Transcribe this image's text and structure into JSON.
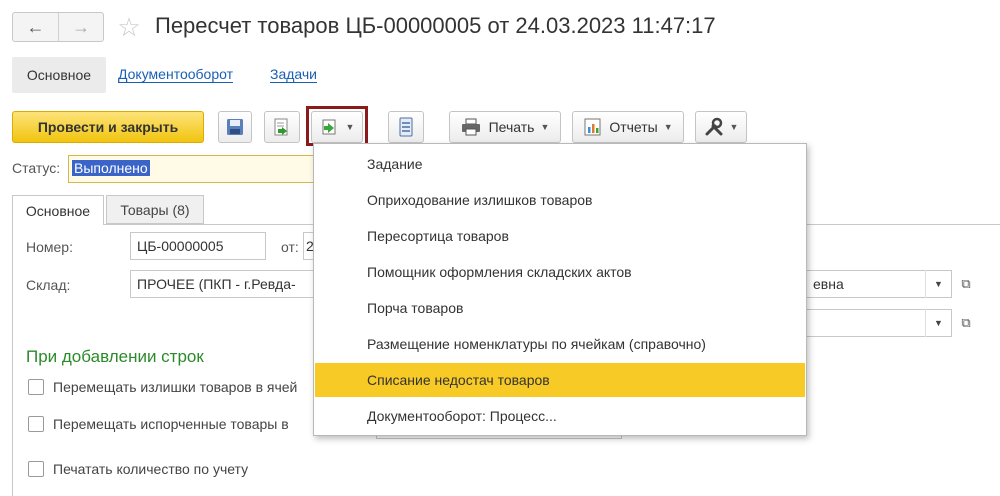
{
  "window": {
    "title": "Пересчет товаров ЦБ-00000005 от 24.03.2023 11:47:17"
  },
  "nav": {
    "back_icon": "arrow-left-icon",
    "forward_icon": "arrow-right-icon",
    "favorite_icon": "star-icon"
  },
  "top_tabs": {
    "main": "Основное",
    "docflow": "Документооборот",
    "tasks": "Задачи"
  },
  "toolbar": {
    "post_close": "Провести и закрыть",
    "print": "Печать",
    "reports": "Отчеты"
  },
  "status": {
    "label": "Статус:",
    "value": "Выполнено"
  },
  "inner_tabs": {
    "main": "Основное",
    "goods": "Товары (8)"
  },
  "form": {
    "number_label": "Номер:",
    "number_value": "ЦБ-00000005",
    "from_label": "от:",
    "from_value": "2",
    "warehouse_label": "Склад:",
    "warehouse_value": "ПРОЧЕЕ (ПКП - г.Ревда-",
    "responsible_value": "евна",
    "section_title": "При добавлении строк",
    "checkbox1": "Перемещать излишки товаров в ячей",
    "checkbox2": "Перемещать испорченные товары в",
    "checkbox3": "Печатать количество по учету"
  },
  "menu": {
    "items": [
      "Задание",
      "Оприходование излишков товаров",
      "Пересортица товаров",
      "Помощник оформления складских актов",
      "Порча товаров",
      "Размещение номенклатуры по ячейкам (справочно)",
      "Списание недостач товаров",
      "Документооборот: Процесс..."
    ],
    "highlighted_index": 6
  },
  "colors": {
    "accent_yellow": "#f7ca25",
    "link_blue": "#1a5fb4",
    "section_green": "#2b8a2b",
    "active_frame": "#8b1a1a",
    "selection_blue": "#3a64c8"
  }
}
